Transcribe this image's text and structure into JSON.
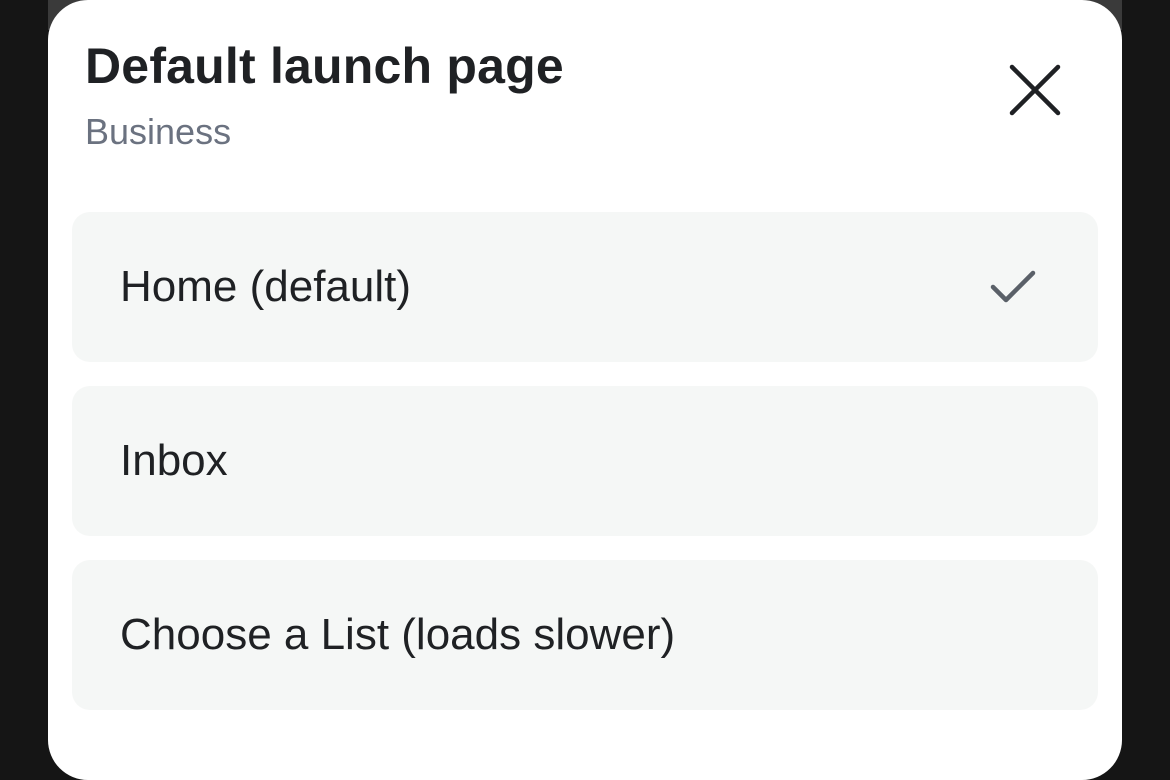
{
  "dialog": {
    "title": "Default launch page",
    "subtitle": "Business",
    "close_icon": "close-icon"
  },
  "options": [
    {
      "label": "Home (default)",
      "selected": true,
      "icon": "checkmark-icon"
    },
    {
      "label": "Inbox",
      "selected": false
    },
    {
      "label": "Choose a List (loads slower)",
      "selected": false
    }
  ],
  "colors": {
    "option_background": "#f5f7f6",
    "title_text": "#1f2124",
    "subtitle_text": "#6b7280",
    "checkmark": "#5a6068"
  }
}
